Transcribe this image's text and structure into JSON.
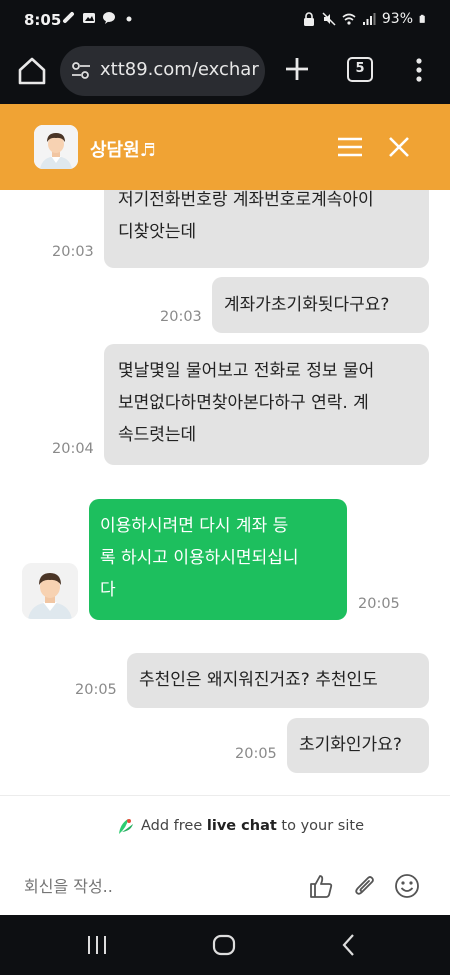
{
  "status_bar": {
    "time": "8:05",
    "battery": "93%"
  },
  "browser": {
    "url": "xtt89.com/exchar",
    "tab_count": "5"
  },
  "chat_header": {
    "agent_name": "상담원♬"
  },
  "messages": [
    {
      "sender": "visitor",
      "lines": [
        "저기전화번호랑 계좌번호로계속아이",
        "디찾앗는데"
      ],
      "time": "20:03"
    },
    {
      "sender": "visitor",
      "lines": [
        "계좌가초기화됫다구요?"
      ],
      "time": "20:03"
    },
    {
      "sender": "visitor",
      "lines": [
        "몇날몇일 물어보고 전화로 정보 물어",
        "보면없다하면찾아본다하구 연락. 계",
        "속드렷는데"
      ],
      "time": "20:04"
    },
    {
      "sender": "agent",
      "lines": [
        "이용하시려면 다시 계좌 등",
        "록 하시고 이용하시면되십니",
        "다"
      ],
      "time": "20:05"
    },
    {
      "sender": "visitor",
      "lines": [
        "추천인은 왜지워진거죠? 추천인도"
      ],
      "time": "20:05"
    },
    {
      "sender": "visitor",
      "lines": [
        "초기화인가요?"
      ],
      "time": "20:05"
    }
  ],
  "branding": {
    "prefix": "Add free ",
    "highlight": "live chat",
    "suffix": " to your site"
  },
  "composer": {
    "placeholder": "회신을 작성.."
  },
  "colors": {
    "header": "#f0a334",
    "agent_bubble": "#1dbf5e",
    "visitor_bubble": "#e3e3e3",
    "system_bar": "#0d0f12"
  }
}
